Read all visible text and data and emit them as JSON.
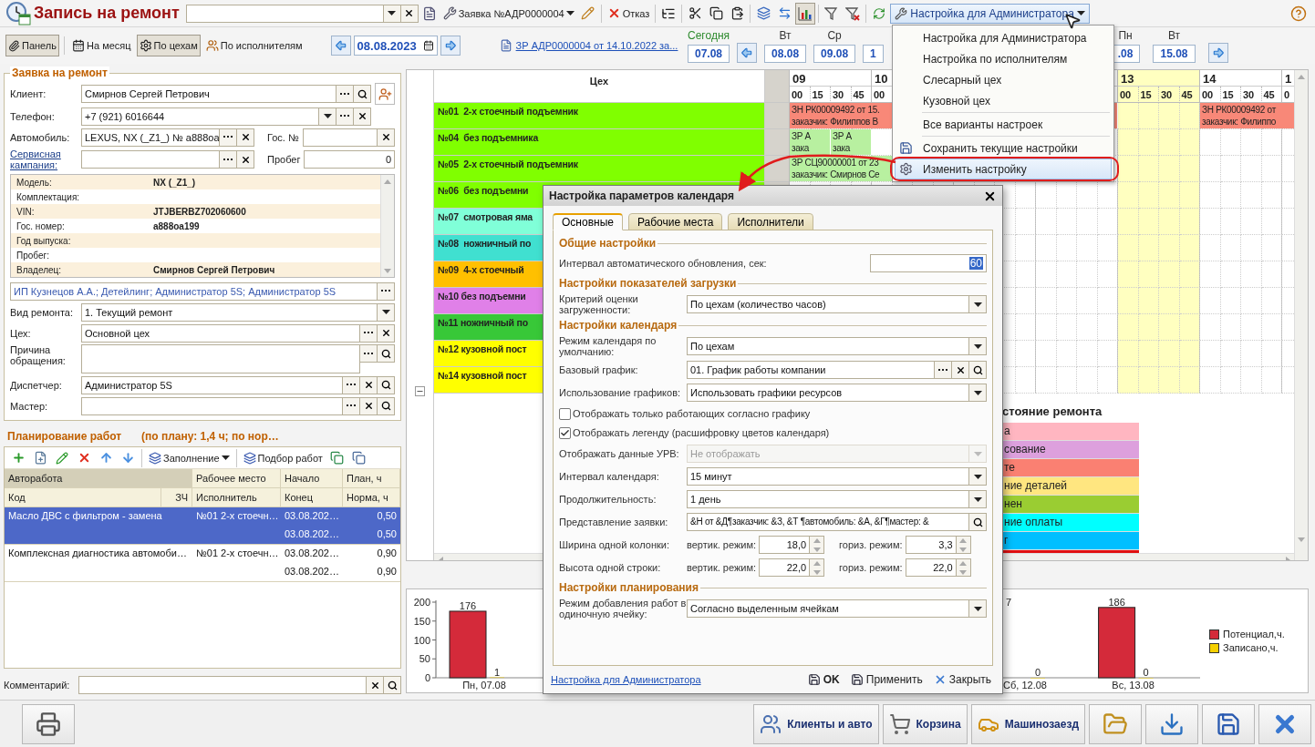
{
  "app": {
    "title": "Запись на ремонт"
  },
  "toolbar": {
    "request_button": "Заявка №АДР0000004",
    "cancel_button": "Отказ",
    "chart_on": true,
    "settings_button": "Настройка для Администратора"
  },
  "view_bar": {
    "panel": {
      "label": "Панель",
      "on": true
    },
    "modes": [
      {
        "label": "На месяц",
        "selected": false
      },
      {
        "label": "По цехам",
        "selected": true
      },
      {
        "label": "По исполнителям",
        "selected": false
      }
    ],
    "date": "08.08.2023",
    "link": "ЗР АДР0000004 от 14.10.2022 за...",
    "days_left": [
      {
        "day": "Сегодня",
        "date": "07.08",
        "today": true
      },
      {
        "day": "Вт",
        "date": "08.08",
        "today": false
      },
      {
        "day": "Ср",
        "date": "09.08",
        "today": false
      },
      {
        "date": "1"
      }
    ],
    "days_right": [
      {
        "day": "Пн",
        "date": ".08",
        "today": false
      },
      {
        "day": "Вт",
        "date": "15.08",
        "today": false
      }
    ]
  },
  "request_form": {
    "title": "Заявка на ремонт",
    "client": {
      "label": "Клиент:",
      "value": "Смирнов Сергей Петрович"
    },
    "phone": {
      "label": "Телефон:",
      "value": "+7 (921) 6016644"
    },
    "car": {
      "label": "Автомобиль:",
      "value": "LEXUS, NX (_Z1_) № a888oa"
    },
    "plate": {
      "label": "Гос. №"
    },
    "campaign": {
      "label": "Сервисная кампания:"
    },
    "mileage": {
      "label": "Пробег",
      "value": "0"
    },
    "car_info": [
      {
        "label": "Модель:",
        "value": "NX (_Z1_)"
      },
      {
        "label": "Комплектация:"
      },
      {
        "label": "VIN:",
        "value": "JTJBERBZ702060600"
      },
      {
        "label": "Гос. номер:",
        "value": "a888oa199"
      },
      {
        "label": "Год выпуска:"
      },
      {
        "label": "Пробег:"
      },
      {
        "label": "Владелец:",
        "value": "Смирнов Сергей Петрович"
      }
    ],
    "assignees": "ИП Кузнецов А.А.; Детейлинг; Администратор 5S; Администратор 5S",
    "repair_type": {
      "label": "Вид ремонта:",
      "value": "1. Текущий ремонт"
    },
    "shop": {
      "label": "Цех:",
      "value": "Основной цех"
    },
    "reason": {
      "label": "Причина обращения:"
    },
    "dispatcher": {
      "label": "Диспетчер:",
      "value": "Администратор 5S"
    },
    "master": {
      "label": "Мастер:"
    }
  },
  "work_planning": {
    "title": "Планирование работ",
    "summary": "(по плану: 1,4 ч; по нор…",
    "fill_button": "Заполнение",
    "pick_button": "Подбор работ",
    "header_top": [
      "Авторабота",
      "Рабочее место",
      "Начало",
      "План, ч"
    ],
    "header_bottom": [
      "Код",
      "ЗЧ",
      "Исполнитель",
      "Конец",
      "Норма, ч"
    ],
    "rows": [
      {
        "work": "Масло ДВС с фильтром - замена",
        "place": "№01  2-х стоечн…",
        "start": "03.08.202…",
        "end": "03.08.202…",
        "plan": "0,50",
        "norm": "0,50",
        "selected": true
      },
      {
        "work": "Комплексная диагностика автомоби…",
        "place": "№01  2-х стоечн…",
        "start": "03.08.202…",
        "end": "03.08.202…",
        "plan": "0,90",
        "norm": "0,90",
        "selected": false
      }
    ]
  },
  "comment": {
    "label": "Комментарий:"
  },
  "calendar": {
    "shop_header": "Цех",
    "hours": [
      {
        "label": "09",
        "subs": [
          "00",
          "15",
          "30",
          "45"
        ],
        "highlight": false
      },
      {
        "label": "10",
        "subs": [
          "00"
        ],
        "highlight": false
      },
      {
        "label": "13",
        "subs": [
          "00",
          "15",
          "30",
          "45"
        ],
        "highlight": true
      },
      {
        "label": "14",
        "subs": [
          "00",
          "15",
          "30",
          "45"
        ],
        "highlight": false
      },
      {
        "label": "1",
        "subs": [
          "0"
        ],
        "highlight": false
      }
    ],
    "rows": [
      {
        "label": "№01  2-х стоечный подъемник",
        "color": "#80ff00",
        "events": [
          {
            "line1": "ЗН РК00009492 от 15.",
            "line2": "заказчик: Филиппов В",
            "color": "#f88878"
          },
          {
            "line1": "ЗН РК00009492 от",
            "line2": "заказчик: Филиппо",
            "color": "#f88878"
          }
        ]
      },
      {
        "label": "№04  без подъемника",
        "color": "#80ff00",
        "events": [
          {
            "line1": "ЗР А",
            "line2": "зака",
            "color": "#b8f0a0"
          },
          {
            "line1": "ЗР А",
            "line2": "зака",
            "color": "#b8f0a0"
          }
        ]
      },
      {
        "label": "№05  2-х стоечный подъемник",
        "color": "#80ff00",
        "events": [
          {
            "line1": "ЗР СЦ90000001 от 23",
            "line2": "заказчик: Смирнов Се",
            "color": "#b8f0a0"
          }
        ]
      },
      {
        "label": "№06  без подъемни",
        "color": "#80ff00"
      },
      {
        "label": "№07  смотровая яма",
        "color": "#80ffd8"
      },
      {
        "label": "№08  ножничный по",
        "color": "#40e0d0"
      },
      {
        "label": "№09  4-х стоечный",
        "color": "#ffc000"
      },
      {
        "label": "№10 без подъемни",
        "color": "#e080e8"
      },
      {
        "label": "№11 ножничный по",
        "color": "#38c838"
      },
      {
        "label": "№12 кузовной пост",
        "color": "#ffff00"
      },
      {
        "label": "№14 кузовной пост",
        "color": "#ffff00"
      }
    ],
    "legend": {
      "title": "стояние ремонта",
      "items": [
        {
          "label": "а",
          "color": "#ffb6c1"
        },
        {
          "label": "сование",
          "color": "#dda0dd"
        },
        {
          "label": "те",
          "color": "#fa8072"
        },
        {
          "label": "ние деталей",
          "color": "#ffe680"
        },
        {
          "label": "нен",
          "color": "#9acd32"
        },
        {
          "label": "ние оплаты",
          "color": "#00ffff"
        },
        {
          "label": "г",
          "color": "#00bfff"
        }
      ]
    }
  },
  "chart": {
    "chart_data": {
      "type": "bar",
      "categories": [
        "Пн, 07.08",
        null,
        null,
        null,
        null,
        "Сб, 12.08",
        "Вс, 13.08"
      ],
      "series": [
        {
          "name": "Потенциал,ч.",
          "color": "#d42a3a",
          "values": [
            176,
            null,
            null,
            null,
            null,
            null,
            186
          ],
          "value_labels": [
            "176",
            null,
            null,
            null,
            null,
            "7",
            "186"
          ]
        },
        {
          "name": "Записано,ч.",
          "color": "#f5d000",
          "values": [
            1,
            null,
            null,
            null,
            null,
            0,
            0
          ],
          "value_labels": [
            "1",
            null,
            null,
            null,
            null,
            "0",
            "0"
          ]
        }
      ],
      "yticks": [
        0,
        50,
        100,
        150,
        200
      ],
      "ylim": [
        0,
        200
      ]
    }
  },
  "menu": {
    "items": [
      {
        "kind": "item",
        "label": "Настройка для Администратора",
        "selected": false
      },
      {
        "kind": "item",
        "label": "Настройка по исполнителям",
        "selected": false
      },
      {
        "kind": "item",
        "label": "Слесарный цех",
        "selected": false
      },
      {
        "kind": "item",
        "label": "Кузовной цех",
        "selected": false
      },
      {
        "kind": "separator"
      },
      {
        "kind": "item",
        "label": "Все варианты настроек",
        "selected": false
      },
      {
        "kind": "separator"
      },
      {
        "kind": "save",
        "label": "Сохранить текущие настройки",
        "selected": false
      },
      {
        "kind": "edit",
        "label": "Изменить настройку",
        "selected": true
      }
    ]
  },
  "dialog": {
    "title": "Настройка параметров календаря",
    "tabs": [
      {
        "label": "Основные",
        "selected": true
      },
      {
        "label": "Рабочие места",
        "selected": false
      },
      {
        "label": "Исполнители",
        "selected": false
      }
    ],
    "sections": [
      {
        "title": "Общие настройки",
        "rows": [
          {
            "kind": "number",
            "label": "Интервал автоматического обновления, сек:",
            "value": "60"
          }
        ]
      },
      {
        "title": "Настройки показателей загрузки",
        "rows": [
          {
            "kind": "select",
            "label": "Критерий оценки загруженности:",
            "value": "По цехам (количество часов)",
            "disabled": false
          }
        ]
      },
      {
        "title": "Настройки календаря",
        "rows": [
          {
            "kind": "select",
            "label": "Режим календаря по умолчанию:",
            "value": "По цехам",
            "disabled": false
          },
          {
            "kind": "lookup",
            "label": "Базовый график:",
            "value": "01. График работы компании"
          },
          {
            "kind": "select",
            "label": "Использование графиков:",
            "value": "Использовать графики ресурсов",
            "disabled": false
          },
          {
            "kind": "checkbox",
            "label": "Отображать только работающих согласно графику",
            "checked": false
          },
          {
            "kind": "checkbox",
            "label": "Отображать легенду (расшифровку цветов календаря)",
            "checked": true
          },
          {
            "kind": "select",
            "label": "Отображать данные УРВ:",
            "value": "Не отображать",
            "disabled": true
          },
          {
            "kind": "select",
            "label": "Интервал календаря:",
            "value": "15 минут",
            "disabled": false
          },
          {
            "kind": "select",
            "label": "Продолжительность:",
            "value": "1 день",
            "disabled": false
          },
          {
            "kind": "search",
            "label": "Представление заявки:",
            "value": "&Н от &Д¶заказчик: &З, &Т ¶автомобиль: &А, &Г¶мастер: &"
          },
          {
            "kind": "spins",
            "label": "Ширина одной колонки:",
            "vertical_label": "вертик. режим:",
            "vertical": "18,0",
            "horizontal_label": "гориз. режим:",
            "horizontal": "3,3"
          },
          {
            "kind": "spins",
            "label": "Высота одной строки:",
            "vertical_label": "вертик. режим:",
            "vertical": "22,0",
            "horizontal_label": "гориз. режим:",
            "horizontal": "22,0"
          }
        ]
      },
      {
        "title": "Настройки планирования",
        "rows": [
          {
            "kind": "select",
            "label": "Режим добавления работ в одиночную ячейку:",
            "value": "Согласно выделенным ячейкам",
            "disabled": false
          }
        ]
      }
    ],
    "footer_link": "Настройка для Администратора",
    "ok": "OK",
    "apply": "Применить",
    "close": "Закрыть"
  },
  "bottom_bar": {
    "buttons": [
      {
        "label": "Клиенты и авто",
        "kind": "clients"
      },
      {
        "label": "Корзина",
        "kind": "cart"
      },
      {
        "label": "Машинозаезд",
        "kind": "car"
      }
    ]
  }
}
